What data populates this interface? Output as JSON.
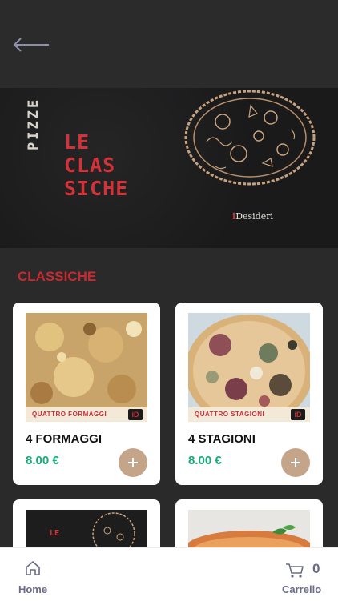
{
  "banner": {
    "vertical_text": "PIZZE",
    "title_lines": [
      "LE",
      "CLAS",
      "SICHE"
    ],
    "brand_prefix": "i",
    "brand_name": "Desideri"
  },
  "section": {
    "title": "CLASSICHE"
  },
  "products": [
    {
      "name": "4 FORMAGGI",
      "price": "8.00 €",
      "tag": "QUATTRO FORMAGGI",
      "tag_logo": "iD"
    },
    {
      "name": "4 STAGIONI",
      "price": "8.00 €",
      "tag": "QUATTRO STAGIONI",
      "tag_logo": "iD"
    }
  ],
  "partial_products": [
    {
      "mini_title": "LE"
    }
  ],
  "tabbar": {
    "home_label": "Home",
    "cart_label": "Carrello",
    "cart_count": "0"
  },
  "colors": {
    "accent_red": "#c82a2f",
    "price_green": "#19a97b",
    "add_button": "#c4a58a",
    "tab_label": "#6b6b8a"
  },
  "icons": [
    "back-arrow-icon",
    "home-icon",
    "cart-icon",
    "plus-icon"
  ]
}
